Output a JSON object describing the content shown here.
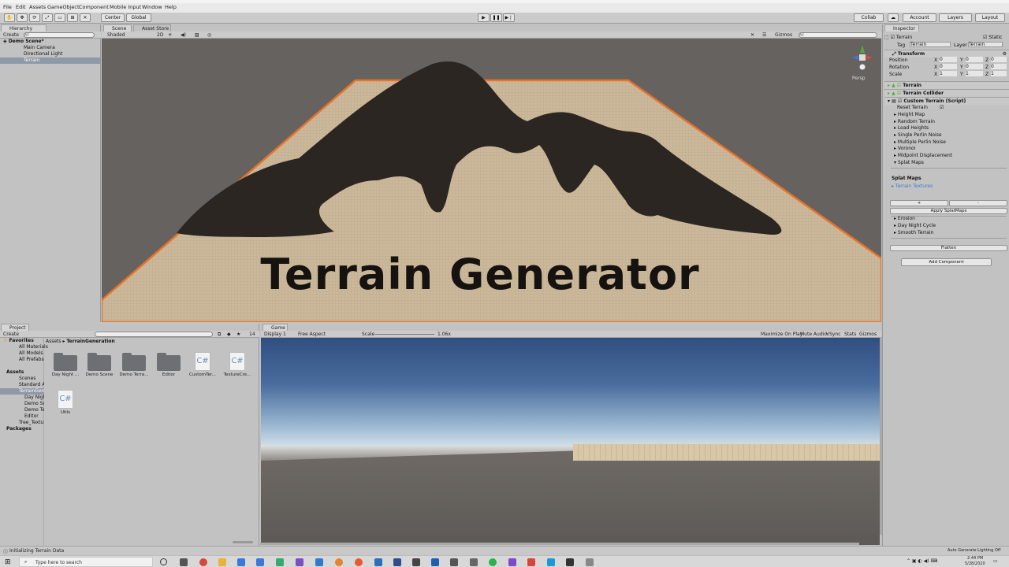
{
  "menu": {
    "items": [
      "File",
      "Edit",
      "Assets",
      "GameObject",
      "Component",
      "Mobile Input",
      "Window",
      "Help"
    ]
  },
  "toolbar": {
    "pivot": "Center",
    "space": "Global",
    "collab": "Collab",
    "account": "Account",
    "layers": "Layers",
    "layout": "Layout"
  },
  "hierarchy": {
    "tab": "Hierarchy",
    "create": "Create",
    "search_placeholder": "All",
    "scene": "Demo Scene*",
    "items": [
      "Main Camera",
      "Directional Light",
      "Terrain"
    ]
  },
  "scene": {
    "tab": "Scene",
    "tab2": "Asset Store",
    "shading": "Shaded",
    "mode": "2D",
    "gizmos": "Gizmos",
    "search_placeholder": "All",
    "persp": "Persp",
    "overlay_title": "Terrain Generator"
  },
  "project": {
    "tab": "Project",
    "create": "Create",
    "count": "14",
    "breadcrumb": [
      "Assets",
      "TerrainGeneration"
    ],
    "favorites": {
      "label": "Favorites",
      "items": [
        "All Materials",
        "All Models",
        "All Prefabs"
      ]
    },
    "assets": {
      "label": "Assets",
      "items": [
        "Scenes",
        "Standard Assets",
        "TerrainGeneration",
        "Day Night Cycle",
        "Demo Scene",
        "Demo Terrain",
        "Editor",
        "Tree_Textures"
      ]
    },
    "packages": "Packages",
    "files": [
      {
        "name": "Day Night ...",
        "kind": "folder"
      },
      {
        "name": "Demo Scene",
        "kind": "folder"
      },
      {
        "name": "Demo Terra...",
        "kind": "folder"
      },
      {
        "name": "Editor",
        "kind": "folder"
      },
      {
        "name": "CustomTer...",
        "kind": "script"
      },
      {
        "name": "TextureCre...",
        "kind": "script"
      },
      {
        "name": "Utils",
        "kind": "script"
      }
    ],
    "cs_glyph": "C#"
  },
  "game": {
    "tab": "Game",
    "display": "Display 1",
    "aspect": "Free Aspect",
    "scale_label": "Scale",
    "scale_value": "1.06x",
    "maximize": "Maximize On Play",
    "mute": "Mute Audio",
    "vsync": "VSync",
    "stats": "Stats",
    "gizmos": "Gizmos"
  },
  "inspector": {
    "tab": "Inspector",
    "object_name": "Terrain",
    "static_label": "Static",
    "tag_label": "Tag",
    "tag_value": "Terrain",
    "layer_label": "Layer",
    "layer_value": "Terrain",
    "transform": {
      "label": "Transform",
      "rows": [
        {
          "label": "Position",
          "x": "0",
          "y": "0",
          "z": "0"
        },
        {
          "label": "Rotation",
          "x": "0",
          "y": "0",
          "z": "0"
        },
        {
          "label": "Scale",
          "x": "1",
          "y": "1",
          "z": "1"
        }
      ]
    },
    "components": [
      "Terrain",
      "Terrain Collider",
      "Custom Terrain (Script)"
    ],
    "reset_terrain": "Reset Terrain",
    "foldouts": [
      "Height Map",
      "Random Terrain",
      "Load Heights",
      "Single Perlin Noise",
      "Multiple Perlin Noise",
      "Voronoi",
      "Midpoint Displacement",
      "Splat Maps"
    ],
    "splat_title": "Splat Maps",
    "splat_link": "Terrain Textures",
    "plus": "+",
    "minus": "-",
    "apply_splat": "Apply SplatMaps",
    "foldouts2": [
      "Erosion",
      "Day Night Cycle",
      "Smooth Terrain"
    ],
    "flatten": "Flatten",
    "add_component": "Add Component",
    "axis": [
      "X",
      "Y",
      "Z"
    ]
  },
  "status": {
    "message": "Initializing Terrain Data",
    "lighting": "Auto Generate Lighting Off"
  },
  "taskbar": {
    "search_placeholder": "Type here to search",
    "time": "2:44 PM",
    "date": "5/28/2020"
  },
  "colors": {
    "selection_orange": "#e8732a",
    "accent_blue": "#3b78d8",
    "terrain_sand": "#cbb89a"
  }
}
